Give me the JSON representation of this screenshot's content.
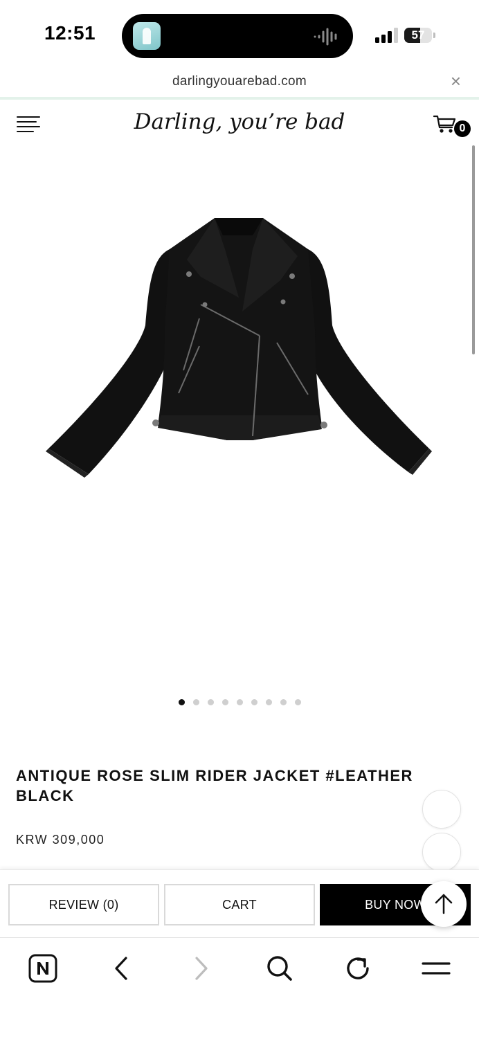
{
  "status_bar": {
    "time": "12:51",
    "battery_level": 57,
    "battery_label": "57"
  },
  "browser": {
    "url": "darlingyouarebad.com",
    "close_label": "×"
  },
  "site": {
    "logo": "Darling, you’re bad",
    "cart_count": "0"
  },
  "carousel": {
    "count": 9,
    "active_index": 0
  },
  "product": {
    "title": "ANTIQUE ROSE SLIM RIDER JACKET #LEATHER BLACK",
    "price": "KRW 309,000",
    "image_icon": "leather-jacket-image"
  },
  "actions": {
    "review": "REVIEW (0)",
    "cart": "CART",
    "buy": "BUY NOW"
  },
  "browser_nav": [
    "naver-home-icon",
    "back-icon",
    "forward-icon",
    "search-icon",
    "refresh-icon",
    "menu-icon"
  ],
  "colors": {
    "accent_line": "#e3f2ea",
    "buy_bg": "#000000",
    "text": "#111111"
  }
}
